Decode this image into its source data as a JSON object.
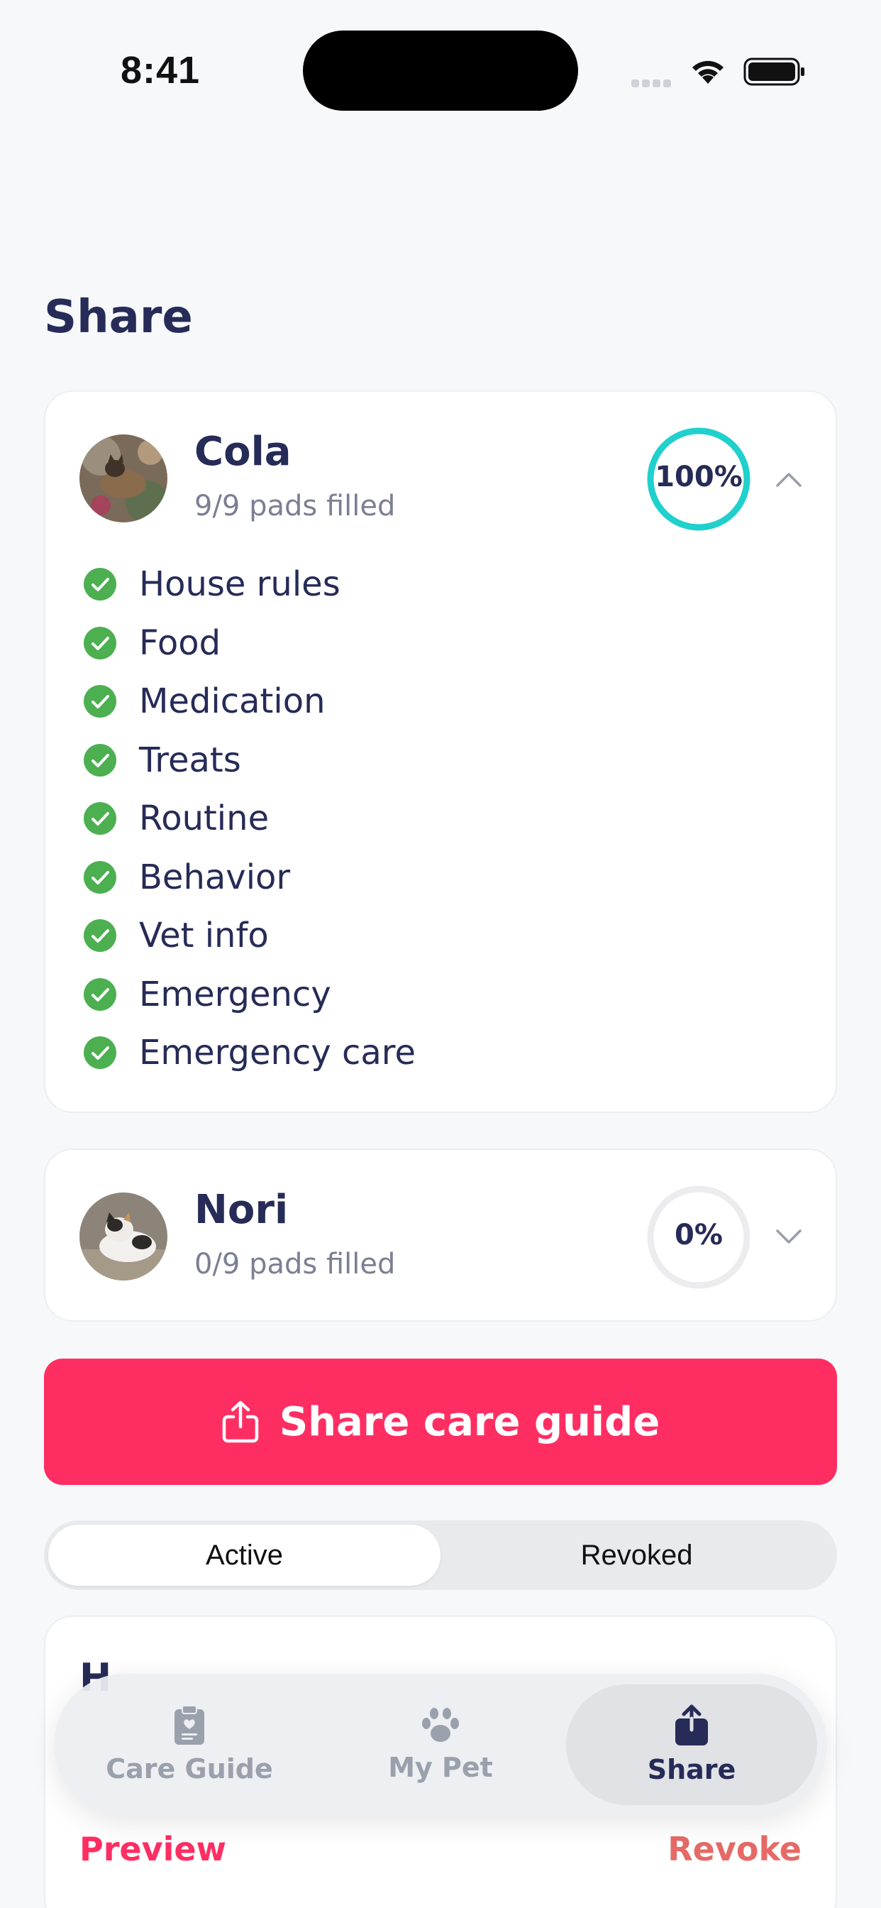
{
  "status_bar": {
    "time": "8:41"
  },
  "page": {
    "title": "Share"
  },
  "pets": [
    {
      "name": "Cola",
      "pads_filled": "9/9 pads filled",
      "progress_label": "100%",
      "progress": 1.0,
      "expanded": true,
      "checklist": [
        "House rules",
        "Food",
        "Medication",
        "Treats",
        "Routine",
        "Behavior",
        "Vet info",
        "Emergency",
        "Emergency care"
      ]
    },
    {
      "name": "Nori",
      "pads_filled": "0/9 pads filled",
      "progress_label": "0%",
      "progress": 0.0,
      "expanded": false
    }
  ],
  "share_button": {
    "label": "Share care guide"
  },
  "segments": {
    "active": "Active",
    "revoked": "Revoked",
    "selected": "Active"
  },
  "link_card": {
    "title": "H",
    "preview": "Preview",
    "revoke": "Revoke"
  },
  "tab_bar": {
    "tabs": [
      {
        "label": "Care Guide",
        "icon": "clipboard-icon"
      },
      {
        "label": "My Pet",
        "icon": "paw-icon"
      },
      {
        "label": "Share",
        "icon": "share-icon"
      }
    ],
    "selected": "Share"
  },
  "colors": {
    "accent": "#ff2e62",
    "progress_complete": "#1fd0cc",
    "check": "#4caf50",
    "text_primary": "#262b57",
    "text_secondary": "#7b7f93",
    "revoke": "#e56a66"
  }
}
